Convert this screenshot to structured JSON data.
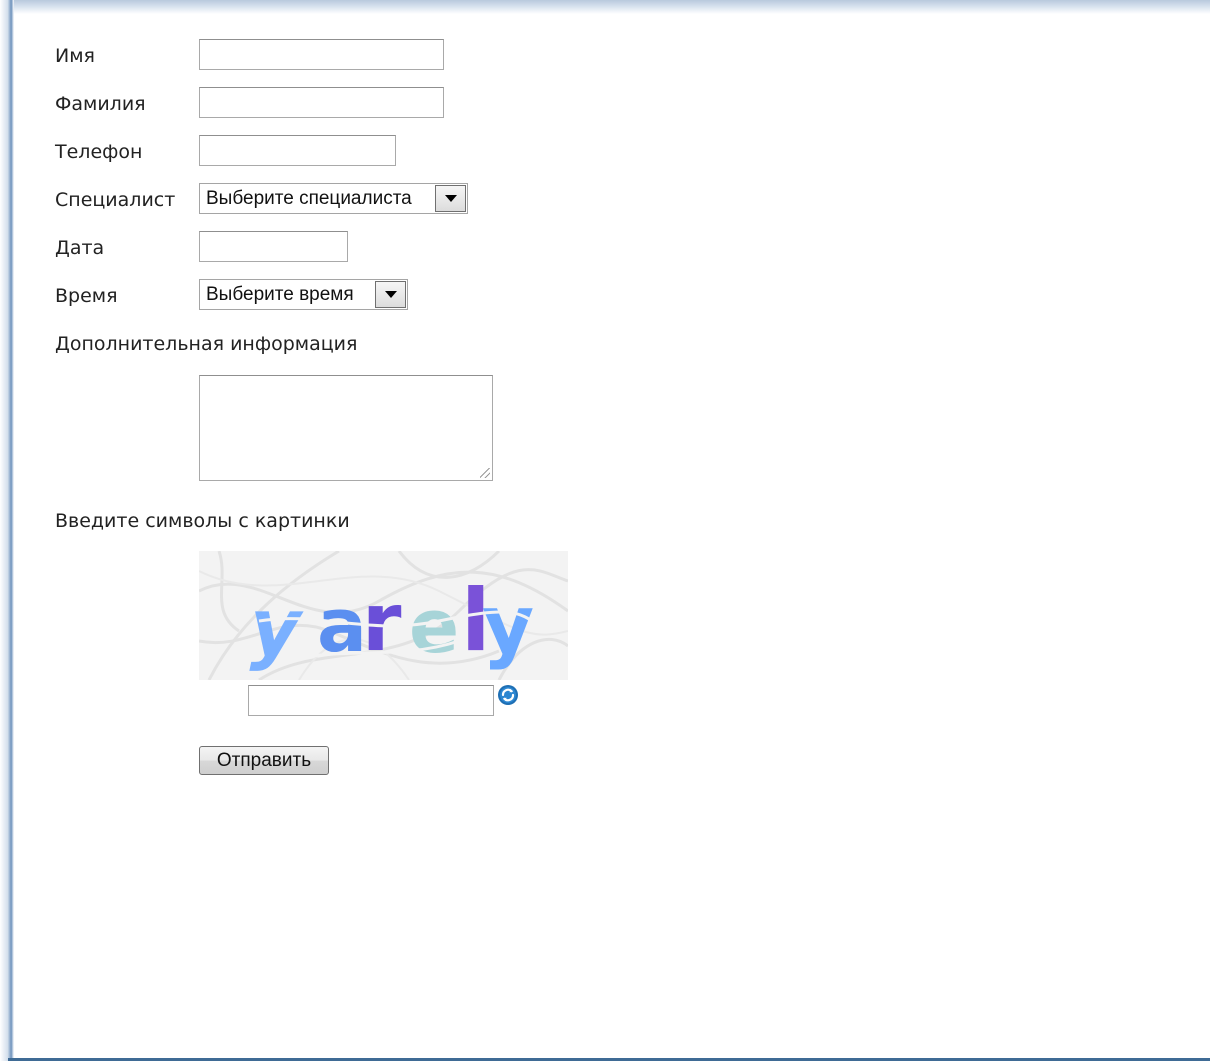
{
  "form": {
    "first_name": {
      "label": "Имя",
      "value": ""
    },
    "last_name": {
      "label": "Фамилия",
      "value": ""
    },
    "phone": {
      "label": "Телефон",
      "value": ""
    },
    "specialist": {
      "label": "Специалист",
      "selected": "Выберите специалиста"
    },
    "date": {
      "label": "Дата",
      "value": ""
    },
    "time": {
      "label": "Время",
      "selected": "Выберите время"
    },
    "additional_info": {
      "label": "Дополнительная информация",
      "value": ""
    },
    "captcha": {
      "label": "Введите символы с картинки",
      "image_text": "yarely",
      "value": "",
      "refresh_icon": "refresh-icon",
      "refresh_color": "#1e6fb4"
    },
    "submit_label": "Отправить"
  },
  "colors": {
    "frame_accent": "#3f6b95",
    "captcha_letters": [
      "#7ab0ff",
      "#5b8ff0",
      "#6a4fd8",
      "#a7d4d8",
      "#7a52d8",
      "#6aa8ff"
    ]
  }
}
